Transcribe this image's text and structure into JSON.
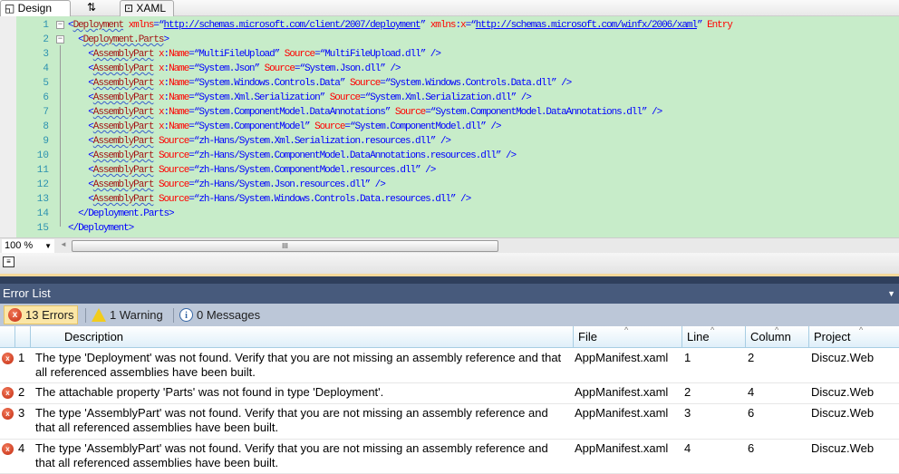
{
  "tabs": {
    "design": "Design",
    "swap": "⇅",
    "xaml": "XAML"
  },
  "code_lines": [
    {
      "n": "1",
      "fold": "−",
      "tokens": [
        [
          "p",
          "<"
        ],
        [
          "e",
          "Deployment"
        ],
        [
          "a",
          " xmlns"
        ],
        [
          "p",
          "=“"
        ],
        [
          "u",
          "http://schemas.microsoft.com/client/2007/deployment"
        ],
        [
          "p",
          "” "
        ],
        [
          "a",
          "xmlns"
        ],
        [
          "p",
          ":"
        ],
        [
          "a",
          "x"
        ],
        [
          "p",
          "=“"
        ],
        [
          "u",
          "http://schemas.microsoft.com/winfx/2006/xaml"
        ],
        [
          "p",
          "” "
        ],
        [
          "a",
          "Entry"
        ]
      ]
    },
    {
      "n": "2",
      "fold": "−",
      "tokens": [
        [
          "p",
          "  <"
        ],
        [
          "e",
          "Deployment.Parts"
        ],
        [
          "p",
          ">"
        ]
      ]
    },
    {
      "n": "3",
      "tokens": [
        [
          "p",
          "    <"
        ],
        [
          "e",
          "AssemblyPart"
        ],
        [
          "a",
          " x"
        ],
        [
          "p",
          ":"
        ],
        [
          "a",
          "Name"
        ],
        [
          "p",
          "=“"
        ],
        [
          "v",
          "MultiFileUpload"
        ],
        [
          "p",
          "” "
        ],
        [
          "a",
          "Source"
        ],
        [
          "p",
          "=“"
        ],
        [
          "v",
          "MultiFileUpload.dll"
        ],
        [
          "p",
          "” />"
        ]
      ]
    },
    {
      "n": "4",
      "tokens": [
        [
          "p",
          "    <"
        ],
        [
          "e",
          "AssemblyPart"
        ],
        [
          "a",
          " x"
        ],
        [
          "p",
          ":"
        ],
        [
          "a",
          "Name"
        ],
        [
          "p",
          "=“"
        ],
        [
          "v",
          "System.Json"
        ],
        [
          "p",
          "” "
        ],
        [
          "a",
          "Source"
        ],
        [
          "p",
          "=“"
        ],
        [
          "v",
          "System.Json.dll"
        ],
        [
          "p",
          "” />"
        ]
      ]
    },
    {
      "n": "5",
      "tokens": [
        [
          "p",
          "    <"
        ],
        [
          "e",
          "AssemblyPart"
        ],
        [
          "a",
          " x"
        ],
        [
          "p",
          ":"
        ],
        [
          "a",
          "Name"
        ],
        [
          "p",
          "=“"
        ],
        [
          "v",
          "System.Windows.Controls.Data"
        ],
        [
          "p",
          "” "
        ],
        [
          "a",
          "Source"
        ],
        [
          "p",
          "=“"
        ],
        [
          "v",
          "System.Windows.Controls.Data.dll"
        ],
        [
          "p",
          "” />"
        ]
      ]
    },
    {
      "n": "6",
      "tokens": [
        [
          "p",
          "    <"
        ],
        [
          "e",
          "AssemblyPart"
        ],
        [
          "a",
          " x"
        ],
        [
          "p",
          ":"
        ],
        [
          "a",
          "Name"
        ],
        [
          "p",
          "=“"
        ],
        [
          "v",
          "System.Xml.Serialization"
        ],
        [
          "p",
          "” "
        ],
        [
          "a",
          "Source"
        ],
        [
          "p",
          "=“"
        ],
        [
          "v",
          "System.Xml.Serialization.dll"
        ],
        [
          "p",
          "” />"
        ]
      ]
    },
    {
      "n": "7",
      "tokens": [
        [
          "p",
          "    <"
        ],
        [
          "e",
          "AssemblyPart"
        ],
        [
          "a",
          " x"
        ],
        [
          "p",
          ":"
        ],
        [
          "a",
          "Name"
        ],
        [
          "p",
          "=“"
        ],
        [
          "v",
          "System.ComponentModel.DataAnnotations"
        ],
        [
          "p",
          "” "
        ],
        [
          "a",
          "Source"
        ],
        [
          "p",
          "=“"
        ],
        [
          "v",
          "System.ComponentModel.DataAnnotations.dll"
        ],
        [
          "p",
          "” />"
        ]
      ]
    },
    {
      "n": "8",
      "tokens": [
        [
          "p",
          "    <"
        ],
        [
          "e",
          "AssemblyPart"
        ],
        [
          "a",
          " x"
        ],
        [
          "p",
          ":"
        ],
        [
          "a",
          "Name"
        ],
        [
          "p",
          "=“"
        ],
        [
          "v",
          "System.ComponentModel"
        ],
        [
          "p",
          "” "
        ],
        [
          "a",
          "Source"
        ],
        [
          "p",
          "=“"
        ],
        [
          "v",
          "System.ComponentModel.dll"
        ],
        [
          "p",
          "” />"
        ]
      ]
    },
    {
      "n": "9",
      "tokens": [
        [
          "p",
          "    <"
        ],
        [
          "e",
          "AssemblyPart"
        ],
        [
          "a",
          " Source"
        ],
        [
          "p",
          "=“"
        ],
        [
          "v",
          "zh-Hans/System.Xml.Serialization.resources.dll"
        ],
        [
          "p",
          "” />"
        ]
      ]
    },
    {
      "n": "10",
      "tokens": [
        [
          "p",
          "    <"
        ],
        [
          "e",
          "AssemblyPart"
        ],
        [
          "a",
          " Source"
        ],
        [
          "p",
          "=“"
        ],
        [
          "v",
          "zh-Hans/System.ComponentModel.DataAnnotations.resources.dll"
        ],
        [
          "p",
          "” />"
        ]
      ]
    },
    {
      "n": "11",
      "tokens": [
        [
          "p",
          "    <"
        ],
        [
          "e",
          "AssemblyPart"
        ],
        [
          "a",
          " Source"
        ],
        [
          "p",
          "=“"
        ],
        [
          "v",
          "zh-Hans/System.ComponentModel.resources.dll"
        ],
        [
          "p",
          "” />"
        ]
      ]
    },
    {
      "n": "12",
      "tokens": [
        [
          "p",
          "    <"
        ],
        [
          "e",
          "AssemblyPart"
        ],
        [
          "a",
          " Source"
        ],
        [
          "p",
          "=“"
        ],
        [
          "v",
          "zh-Hans/System.Json.resources.dll"
        ],
        [
          "p",
          "” />"
        ]
      ]
    },
    {
      "n": "13",
      "tokens": [
        [
          "p",
          "    <"
        ],
        [
          "e",
          "AssemblyPart"
        ],
        [
          "a",
          " Source"
        ],
        [
          "p",
          "=“"
        ],
        [
          "v",
          "zh-Hans/System.Windows.Controls.Data.resources.dll"
        ],
        [
          "p",
          "” />"
        ]
      ]
    },
    {
      "n": "14",
      "tokens": [
        [
          "p",
          "  </"
        ],
        [
          "v",
          "Deployment.Parts"
        ],
        [
          "p",
          ">"
        ]
      ]
    },
    {
      "n": "15",
      "tokens": [
        [
          "p",
          "</"
        ],
        [
          "v",
          "Deployment"
        ],
        [
          "p",
          ">"
        ]
      ]
    }
  ],
  "zoom": "100 %",
  "error_list": {
    "title": "Error List",
    "filters": {
      "errors": "13 Errors",
      "warnings": "1 Warning",
      "messages": "0 Messages"
    },
    "columns": {
      "description": "Description",
      "file": "File",
      "line": "Line",
      "column": "Column",
      "project": "Project"
    },
    "rows": [
      {
        "num": "1",
        "description": "The type 'Deployment' was not found. Verify that you are not missing an assembly reference and that all referenced assemblies have been built.",
        "file": "AppManifest.xaml",
        "line": "1",
        "column": "2",
        "project": "Discuz.Web"
      },
      {
        "num": "2",
        "description": "The attachable property 'Parts' was not found in type 'Deployment'.",
        "file": "AppManifest.xaml",
        "line": "2",
        "column": "4",
        "project": "Discuz.Web"
      },
      {
        "num": "3",
        "description": "The type 'AssemblyPart' was not found. Verify that you are not missing an assembly reference and that all referenced assemblies have been built.",
        "file": "AppManifest.xaml",
        "line": "3",
        "column": "6",
        "project": "Discuz.Web"
      },
      {
        "num": "4",
        "description": "The type 'AssemblyPart' was not found. Verify that you are not missing an assembly reference and that all referenced assemblies have been built.",
        "file": "AppManifest.xaml",
        "line": "4",
        "column": "6",
        "project": "Discuz.Web"
      }
    ]
  }
}
